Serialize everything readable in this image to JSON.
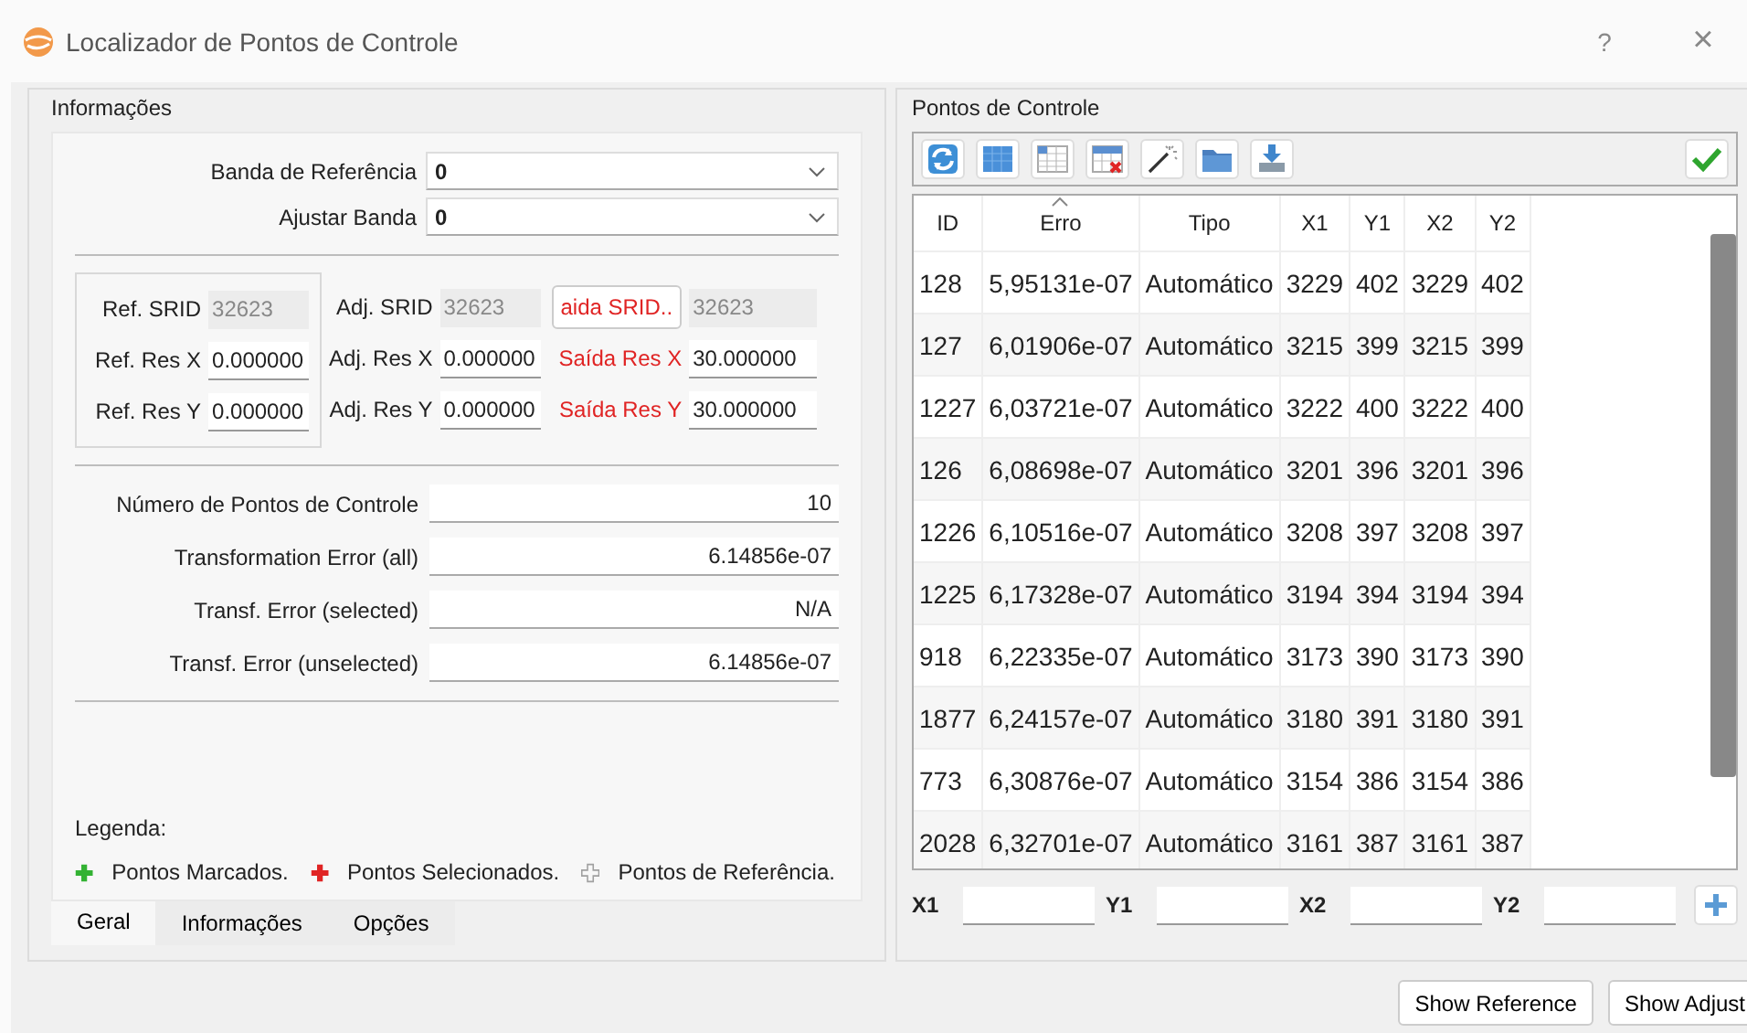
{
  "window": {
    "title": "Localizador de Pontos de Controle",
    "help": "?",
    "close": "×"
  },
  "info_panel": {
    "title": "Informações",
    "bands": [
      {
        "label": "Banda de Referência",
        "value": "0"
      },
      {
        "label": "Ajustar Banda",
        "value": "0"
      }
    ],
    "srid_box": {
      "rows": [
        {
          "kind": "field",
          "label": "Ref. SRID",
          "value": "32623",
          "disabled": true,
          "warning": false
        },
        {
          "kind": "field",
          "label": "Ref. Res X",
          "value": "0.000000",
          "disabled": false,
          "warning": false
        },
        {
          "kind": "field",
          "label": "Ref. Res Y",
          "value": "0.000000",
          "disabled": false,
          "warning": false
        }
      ]
    },
    "srid_columns": [
      {
        "rows": [
          {
            "kind": "field",
            "label": "Adj. SRID",
            "value": "32623",
            "disabled": true,
            "warning": false
          },
          {
            "kind": "field",
            "label": "Adj. Res X",
            "value": "0.000000",
            "disabled": false,
            "warning": false
          },
          {
            "kind": "field",
            "label": "Adj. Res Y",
            "value": "0.000000",
            "disabled": false,
            "warning": false
          }
        ]
      },
      {
        "rows": [
          {
            "kind": "button",
            "label": "aida SRID..",
            "value": "32623",
            "disabled": true,
            "warning": true
          },
          {
            "kind": "field",
            "label": "Saída Res X",
            "value": "30.000000",
            "disabled": false,
            "warning": true
          },
          {
            "kind": "field",
            "label": "Saída Res Y",
            "value": "30.000000",
            "disabled": false,
            "warning": true
          }
        ]
      }
    ],
    "stats": [
      {
        "label": "Número de Pontos de Controle",
        "value": "10"
      },
      {
        "label": "Transformation Error (all)",
        "value": "6.14856e-07"
      },
      {
        "label": "Transf. Error (selected)",
        "value": "N/A"
      },
      {
        "label": "Transf. Error (unselected)",
        "value": "6.14856e-07"
      }
    ],
    "legend_title": "Legenda:",
    "legend": [
      {
        "label": "Pontos Marcados.",
        "kind": "filled",
        "color": "#33b233"
      },
      {
        "label": "Pontos Selecionados.",
        "kind": "filled",
        "color": "#e02424"
      },
      {
        "label": "Pontos de Referência.",
        "kind": "outline",
        "color": "#a0a0a0"
      }
    ],
    "tabs": [
      {
        "label": "Geral",
        "selected": true
      },
      {
        "label": "Informações",
        "selected": false
      },
      {
        "label": "Opções",
        "selected": false
      }
    ]
  },
  "points_panel": {
    "title": "Pontos de Controle",
    "table": {
      "columns": [
        {
          "label": "ID",
          "sorted": false
        },
        {
          "label": "Erro",
          "sorted": true
        },
        {
          "label": "Tipo",
          "sorted": false
        },
        {
          "label": "X1",
          "sorted": false
        },
        {
          "label": "Y1",
          "sorted": false
        },
        {
          "label": "X2",
          "sorted": false
        },
        {
          "label": "Y2",
          "sorted": false
        }
      ],
      "rows": [
        [
          "128",
          "5,95131e-07",
          "Automático",
          "3229",
          "402",
          "3229",
          "402"
        ],
        [
          "127",
          "6,01906e-07",
          "Automático",
          "3215",
          "399",
          "3215",
          "399"
        ],
        [
          "1227",
          "6,03721e-07",
          "Automático",
          "3222",
          "400",
          "3222",
          "400"
        ],
        [
          "126",
          "6,08698e-07",
          "Automático",
          "3201",
          "396",
          "3201",
          "396"
        ],
        [
          "1226",
          "6,10516e-07",
          "Automático",
          "3208",
          "397",
          "3208",
          "397"
        ],
        [
          "1225",
          "6,17328e-07",
          "Automático",
          "3194",
          "394",
          "3194",
          "394"
        ],
        [
          "918",
          "6,22335e-07",
          "Automático",
          "3173",
          "390",
          "3173",
          "390"
        ],
        [
          "1877",
          "6,24157e-07",
          "Automático",
          "3180",
          "391",
          "3180",
          "391"
        ],
        [
          "773",
          "6,30876e-07",
          "Automático",
          "3154",
          "386",
          "3154",
          "386"
        ],
        [
          "2028",
          "6,32701e-07",
          "Automático",
          "3161",
          "387",
          "3161",
          "387"
        ]
      ]
    },
    "inputs": [
      {
        "label": "X1"
      },
      {
        "label": "Y1"
      },
      {
        "label": "X2"
      },
      {
        "label": "Y2"
      }
    ]
  },
  "buttons": [
    "Show Reference",
    "Show Adjust"
  ]
}
